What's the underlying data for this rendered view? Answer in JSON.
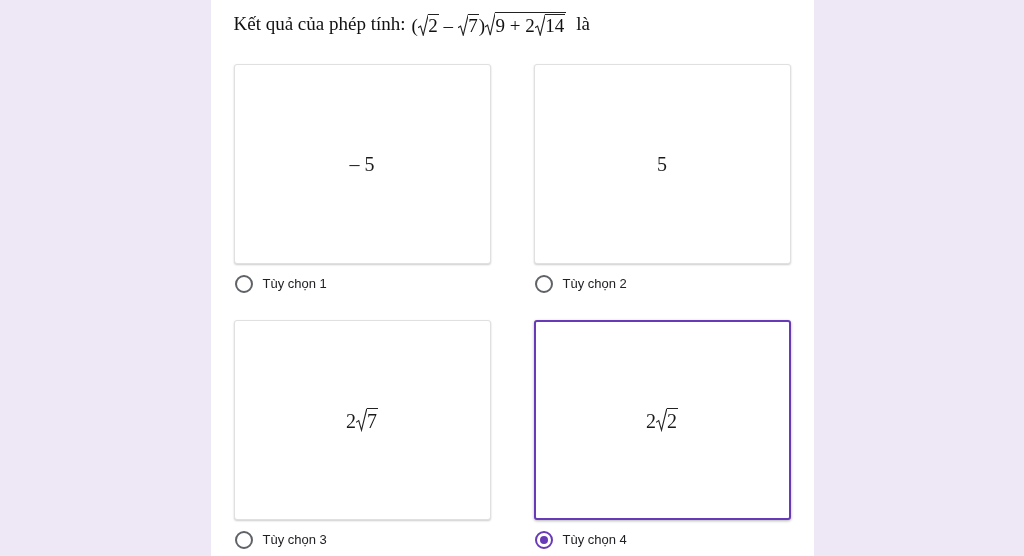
{
  "question": {
    "text": "Kết quả của phép tính:",
    "formula": [
      {
        "kind": "text",
        "text": "("
      },
      {
        "kind": "sqrt",
        "children": [
          {
            "kind": "text",
            "text": "2"
          }
        ]
      },
      {
        "kind": "text",
        "text": " – "
      },
      {
        "kind": "sqrt",
        "children": [
          {
            "kind": "text",
            "text": "7"
          }
        ]
      },
      {
        "kind": "text",
        "text": ")"
      },
      {
        "kind": "sqrt",
        "children": [
          {
            "kind": "text",
            "text": "9 + 2"
          },
          {
            "kind": "sqrt",
            "children": [
              {
                "kind": "text",
                "text": "14"
              }
            ]
          }
        ]
      }
    ],
    "suffix": "là"
  },
  "options": [
    {
      "label": "Tùy chọn 1",
      "selected": false,
      "formula": [
        {
          "kind": "text",
          "text": "– 5"
        }
      ]
    },
    {
      "label": "Tùy chọn 2",
      "selected": false,
      "formula": [
        {
          "kind": "text",
          "text": "5"
        }
      ]
    },
    {
      "label": "Tùy chọn 3",
      "selected": false,
      "formula": [
        {
          "kind": "text",
          "text": "2"
        },
        {
          "kind": "sqrt",
          "children": [
            {
              "kind": "text",
              "text": "7"
            }
          ]
        }
      ]
    },
    {
      "label": "Tùy chọn 4",
      "selected": true,
      "formula": [
        {
          "kind": "text",
          "text": "2"
        },
        {
          "kind": "sqrt",
          "children": [
            {
              "kind": "text",
              "text": "2"
            }
          ]
        }
      ]
    }
  ]
}
